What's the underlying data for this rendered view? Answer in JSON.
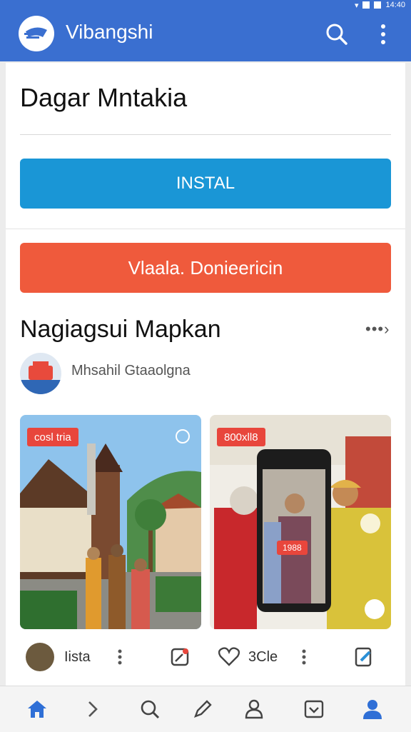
{
  "status_bar": {
    "time": "14:40"
  },
  "app_bar": {
    "title": "Vibangshi",
    "logo_icon": "app-logo-icon",
    "search_icon": "search-icon",
    "more_icon": "more-vert-icon"
  },
  "header": {
    "title": "Dagar Mntakia"
  },
  "buttons": {
    "install_label": "INSTAL",
    "cta_label": "Vlaala. Donieericin"
  },
  "section": {
    "title": "Nagiagsui Mapkan",
    "more_label": "•••›"
  },
  "author": {
    "name": "Mhsahil Gtaaolgna"
  },
  "tiles": [
    {
      "badge": "cosl tria",
      "scene": "colonial-building-people-photo"
    },
    {
      "badge": "800xll8",
      "scene": "people-with-phone-photo",
      "phone_badge": "1988"
    }
  ],
  "actions": {
    "user_label": "Iista",
    "likes_label": "3Cle"
  },
  "colors": {
    "appbar": "#3a6fd0",
    "install": "#1a96d6",
    "cta": "#ef5a3c",
    "badge": "#e8463c",
    "nav_active": "#2f6fd6"
  },
  "bottom_nav": [
    {
      "icon": "home-icon"
    },
    {
      "icon": "chevron-right-icon"
    },
    {
      "icon": "search-icon"
    },
    {
      "icon": "pen-icon"
    },
    {
      "icon": "person-outline-icon"
    },
    {
      "icon": "inbox-icon"
    },
    {
      "icon": "account-icon"
    }
  ]
}
